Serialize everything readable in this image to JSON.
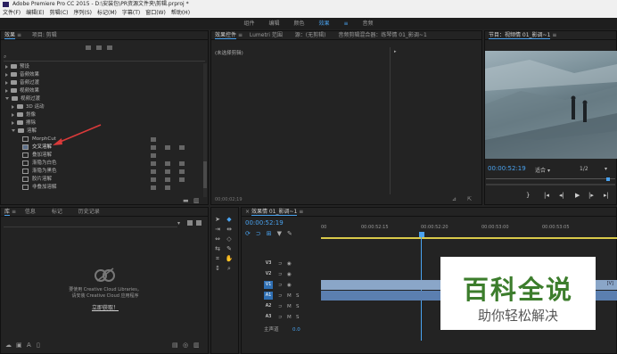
{
  "title": "Adobe Premiere Pro CC 2015 - D:\\安装包\\PR资源文件夹\\剪辑.prproj *",
  "menu": [
    "文件(F)",
    "编辑(E)",
    "剪辑(C)",
    "序列(S)",
    "标记(M)",
    "字幕(T)",
    "窗口(W)",
    "帮助(H)"
  ],
  "workspaces": [
    "组件",
    "编辑",
    "颜色",
    "效果",
    "音频"
  ],
  "active_workspace": "效果",
  "effects_panel": {
    "tabs": [
      "效果",
      "项目: 剪辑"
    ],
    "search_placeholder": "",
    "tree": [
      {
        "label": "预设",
        "expanded": false,
        "indent": 0
      },
      {
        "label": "音频效果",
        "expanded": false,
        "indent": 0
      },
      {
        "label": "音频过渡",
        "expanded": false,
        "indent": 0
      },
      {
        "label": "视频效果",
        "expanded": false,
        "indent": 0
      },
      {
        "label": "视频过渡",
        "expanded": true,
        "indent": 0
      },
      {
        "label": "3D 运动",
        "expanded": false,
        "indent": 1
      },
      {
        "label": "划像",
        "expanded": false,
        "indent": 1
      },
      {
        "label": "擦除",
        "expanded": false,
        "indent": 1
      },
      {
        "label": "溶解",
        "expanded": true,
        "indent": 1
      }
    ],
    "effects": [
      "MorphCut",
      "交叉溶解",
      "叠加溶解",
      "渐隐为白色",
      "渐隐为黑色",
      "胶片溶解",
      "非叠加溶解"
    ]
  },
  "effect_controls": {
    "tabs": [
      "效果控件",
      "Lumetri 范围",
      "源：(无剪辑)",
      "音频剪辑混合器：练琴情 01_影调~1"
    ],
    "no_clip": "(未选择剪辑)",
    "timecode": "00;00;02;19"
  },
  "program_monitor": {
    "tab": "节目：视频情 01_影调~1",
    "timecode": "00:00:52:19",
    "fit": "适合",
    "resolution": "1/2"
  },
  "library_panel": {
    "tabs": [
      "库",
      "信息",
      "标记",
      "历史记录"
    ],
    "message_line1": "要使用 Creative Cloud Libraries，",
    "message_line2": "请安装 Creative Cloud 应用程序",
    "link": "立即获取！"
  },
  "timeline": {
    "tab": "效果情 01_影调~1",
    "timecode": "00:00:52:19",
    "ruler": [
      "00",
      "00:00:52:15",
      "00:00:52:20",
      "00:00:53:00",
      "00:00:53:05"
    ],
    "tracks": [
      {
        "name": "V3",
        "type": "video"
      },
      {
        "name": "V2",
        "type": "video"
      },
      {
        "name": "V1",
        "type": "video"
      },
      {
        "name": "A1",
        "type": "audio"
      },
      {
        "name": "A2",
        "type": "audio"
      },
      {
        "name": "A3",
        "type": "audio"
      }
    ],
    "master": "主声道",
    "master_value": "0.0",
    "clip_badge": "[V]"
  },
  "watermark": {
    "title": "百科全说",
    "subtitle": "助你轻松解决"
  },
  "colors": {
    "accent": "#4aa3f0",
    "clip_video": "#8aa6c8",
    "clip_audio": "#5b7fb0",
    "arrow": "#d93a3a"
  }
}
